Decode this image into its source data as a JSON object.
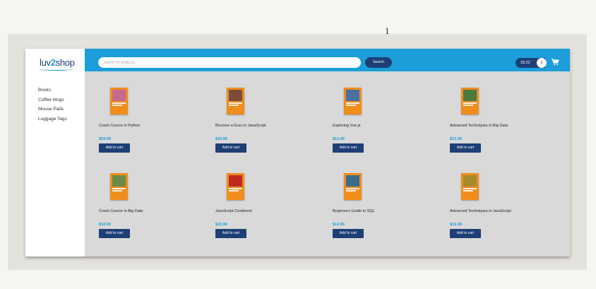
{
  "slide": {
    "number": "1"
  },
  "brand": {
    "prefix": "luv",
    "two": "2",
    "suffix": "shop"
  },
  "categories": [
    "Books",
    "Coffee Mugs",
    "Mouse Pads",
    "Luggage Tags"
  ],
  "search": {
    "placeholder": "Search for products...",
    "button_label": "Search"
  },
  "cart": {
    "total": "18.22",
    "quantity": "2",
    "icon": "shopping-cart-icon"
  },
  "products": [
    {
      "name": "Crash Course in Python",
      "price": "$18.99",
      "button": "Add to cart",
      "cover_color": "#c56a8c"
    },
    {
      "name": "Become a Guru in JavaScript",
      "price": "$20.99",
      "button": "Add to cart",
      "cover_color": "#7a4d3a"
    },
    {
      "name": "Exploring Vue.js",
      "price": "$14.99",
      "button": "Add to cart",
      "cover_color": "#4a6fa0"
    },
    {
      "name": "Advanced Techniques in Big Data",
      "price": "$13.99",
      "button": "Add to cart",
      "cover_color": "#4d7a3c"
    },
    {
      "name": "Crash Course in Big Data",
      "price": "$18.99",
      "button": "Add to cart",
      "cover_color": "#6b8a4a"
    },
    {
      "name": "JavaScript Cookbook",
      "price": "$23.99",
      "button": "Add to cart",
      "cover_color": "#c0281e"
    },
    {
      "name": "Beginners Guide to SQL",
      "price": "$14.99",
      "button": "Add to cart",
      "cover_color": "#3d6b8a"
    },
    {
      "name": "Advanced Techniques in JavaScript",
      "price": "$16.99",
      "button": "Add to cart",
      "cover_color": "#a88a2a"
    }
  ],
  "colors": {
    "accent": "#1b9ed9",
    "navy": "#1d3f76",
    "book_orange": "#f08d1b",
    "content_bg": "#d9d9d9"
  }
}
